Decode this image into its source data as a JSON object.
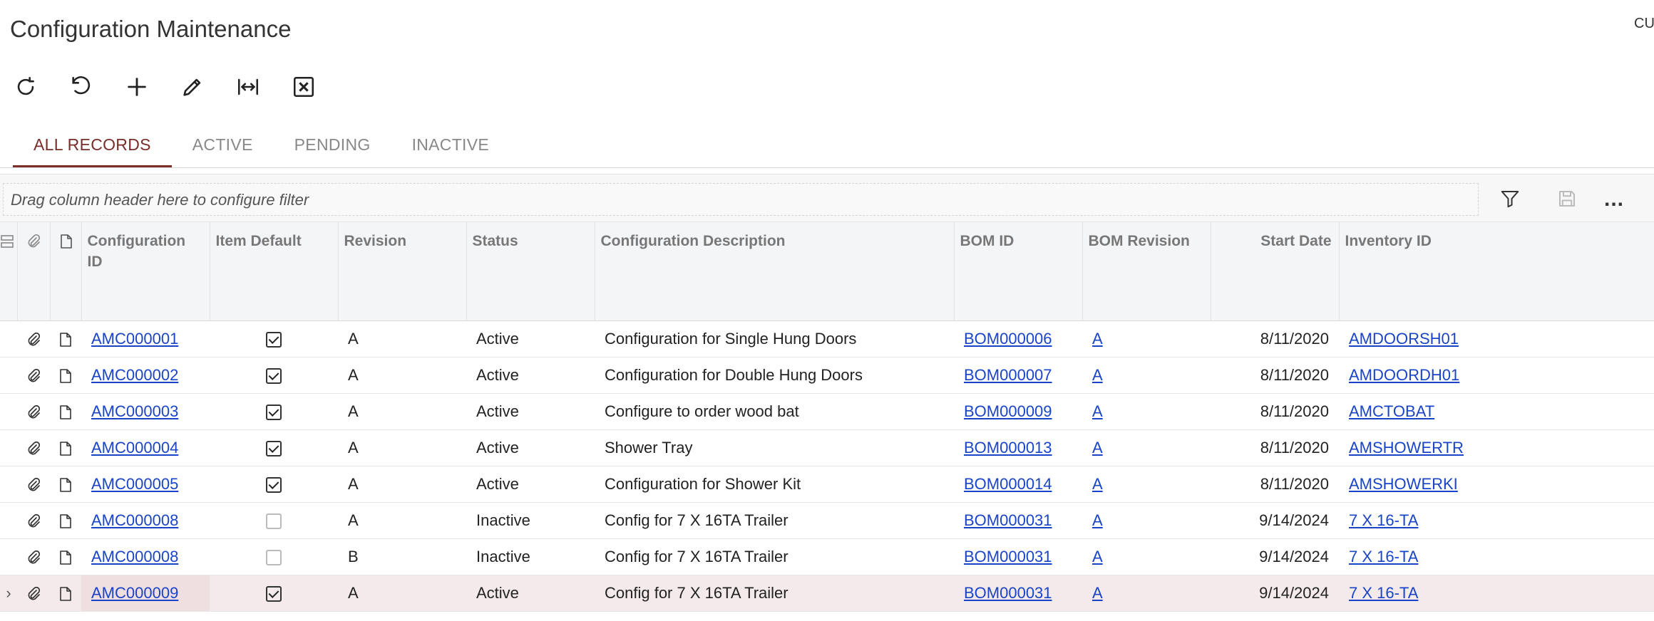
{
  "page": {
    "title": "Configuration Maintenance",
    "top_right_text": "CU"
  },
  "toolbar": {
    "buttons": [
      {
        "name": "refresh-button",
        "icon": "refresh-icon"
      },
      {
        "name": "undo-button",
        "icon": "undo-icon"
      },
      {
        "name": "add-button",
        "icon": "plus-icon"
      },
      {
        "name": "edit-button",
        "icon": "pencil-icon"
      },
      {
        "name": "fit-columns-button",
        "icon": "fit-width-icon"
      },
      {
        "name": "export-excel-button",
        "icon": "excel-icon"
      }
    ]
  },
  "tabs": [
    {
      "label": "ALL RECORDS",
      "active": true
    },
    {
      "label": "ACTIVE",
      "active": false
    },
    {
      "label": "PENDING",
      "active": false
    },
    {
      "label": "INACTIVE",
      "active": false
    }
  ],
  "filter": {
    "placeholder": "Drag column header here to configure filter",
    "more_label": "..."
  },
  "grid": {
    "columns": {
      "config_id": "Configuration ID",
      "item_default": "Item Default",
      "revision": "Revision",
      "status": "Status",
      "description": "Configuration Description",
      "bom_id": "BOM ID",
      "bom_revision": "BOM Revision",
      "start_date": "Start Date",
      "inventory_id": "Inventory ID"
    },
    "rows": [
      {
        "config_id": "AMC000001",
        "item_default": true,
        "revision": "A",
        "status": "Active",
        "description": "Configuration for Single Hung Doors",
        "bom_id": "BOM000006",
        "bom_revision": "A",
        "start_date": "8/11/2020",
        "inventory_id": "AMDOORSH01",
        "selected": false
      },
      {
        "config_id": "AMC000002",
        "item_default": true,
        "revision": "A",
        "status": "Active",
        "description": "Configuration for Double Hung Doors",
        "bom_id": "BOM000007",
        "bom_revision": "A",
        "start_date": "8/11/2020",
        "inventory_id": "AMDOORDH01",
        "selected": false
      },
      {
        "config_id": "AMC000003",
        "item_default": true,
        "revision": "A",
        "status": "Active",
        "description": "Configure to order wood bat",
        "bom_id": "BOM000009",
        "bom_revision": "A",
        "start_date": "8/11/2020",
        "inventory_id": "AMCTOBAT",
        "selected": false
      },
      {
        "config_id": "AMC000004",
        "item_default": true,
        "revision": "A",
        "status": "Active",
        "description": "Shower Tray",
        "bom_id": "BOM000013",
        "bom_revision": "A",
        "start_date": "8/11/2020",
        "inventory_id": "AMSHOWERTR",
        "selected": false
      },
      {
        "config_id": "AMC000005",
        "item_default": true,
        "revision": "A",
        "status": "Active",
        "description": "Configuration for Shower Kit",
        "bom_id": "BOM000014",
        "bom_revision": "A",
        "start_date": "8/11/2020",
        "inventory_id": "AMSHOWERKI",
        "selected": false
      },
      {
        "config_id": "AMC000008",
        "item_default": false,
        "revision": "A",
        "status": "Inactive",
        "description": "Config for 7 X 16TA Trailer",
        "bom_id": "BOM000031",
        "bom_revision": "A",
        "start_date": "9/14/2024",
        "inventory_id": "7 X 16-TA",
        "selected": false
      },
      {
        "config_id": "AMC000008",
        "item_default": false,
        "revision": "B",
        "status": "Inactive",
        "description": "Config for 7 X 16TA Trailer",
        "bom_id": "BOM000031",
        "bom_revision": "A",
        "start_date": "9/14/2024",
        "inventory_id": "7 X 16-TA",
        "selected": false
      },
      {
        "config_id": "AMC000009",
        "item_default": true,
        "revision": "A",
        "status": "Active",
        "description": "Config for 7 X 16TA Trailer",
        "bom_id": "BOM000031",
        "bom_revision": "A",
        "start_date": "9/14/2024",
        "inventory_id": "7 X 16-TA",
        "selected": true
      }
    ]
  }
}
